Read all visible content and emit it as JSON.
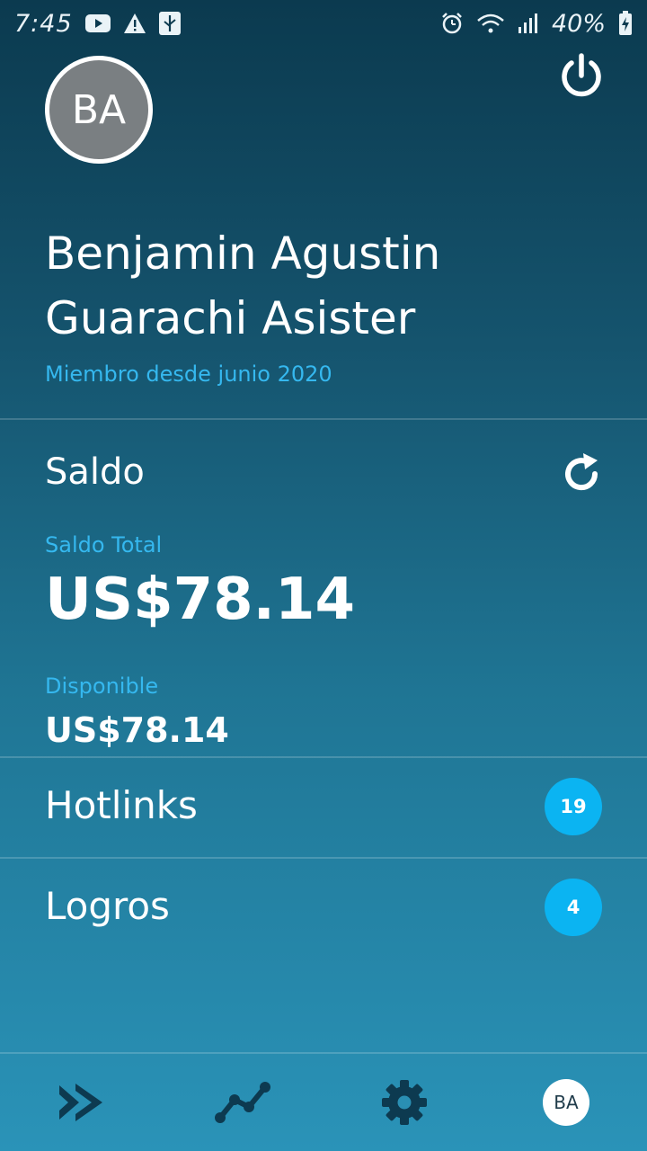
{
  "status_bar": {
    "time": "7:45",
    "battery": "40%",
    "icons_left": [
      "youtube-icon",
      "warning-icon",
      "usb-icon"
    ],
    "icons_right": [
      "alarm-icon",
      "wifi-icon",
      "signal-icon",
      "battery-charging-icon"
    ]
  },
  "profile": {
    "initials": "BA",
    "name_line1": "Benjamin Agustin",
    "name_line2": "Guarachi Asister",
    "member_since": "Miembro desde junio 2020"
  },
  "balance": {
    "title": "Saldo",
    "total_label": "Saldo Total",
    "total_value": "US$78.14",
    "available_label": "Disponible",
    "available_value": "US$78.14"
  },
  "menu": [
    {
      "label": "Hotlinks",
      "badge": "19"
    },
    {
      "label": "Logros",
      "badge": "4"
    }
  ],
  "bottom_nav": {
    "items": [
      "forward-icon",
      "trending-icon",
      "gear-icon",
      "avatar"
    ],
    "avatar_initials": "BA"
  },
  "colors": {
    "accent": "#35b8ef",
    "badge": "#0bb4f2",
    "gradient_top": "#0b3a4f",
    "gradient_bottom": "#2a93b8"
  }
}
